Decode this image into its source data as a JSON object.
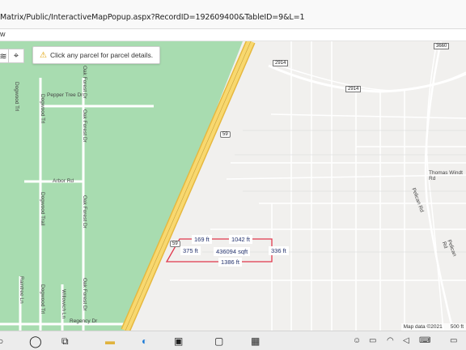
{
  "browser": {
    "url": "Matrix/Public/InteractiveMapPopup.aspx?RecordID=192609400&TableID=9&L=1",
    "menu_fragment": "w"
  },
  "map": {
    "hint_text": "Click any parcel for parcel details.",
    "controls": {
      "layers_icon": "layers-icon",
      "locate_icon": "locate-icon"
    },
    "highway_label": "59",
    "road_shields": [
      "2914",
      "2914",
      "3660"
    ],
    "street_labels": {
      "pepper_tree": "Pepper Tree Dr",
      "dogwood_trl_top": "Dogwood Trl",
      "oak_forest_top": "Oak Forest Dr",
      "oak_forest_2": "Oak Forest Dr",
      "arbor": "Arbor Rd",
      "dogwood_trl_mid": "Dogwood Trail",
      "oak_forest_low": "Oak Forest Dr",
      "dogwood_trl_low": "Dogwood Trl",
      "willowich": "Willowich Ln",
      "raintree": "Raintree Ln",
      "regency": "Regency Dr",
      "thomas_windt": "Thomas Windt Rd",
      "pelican_top": "Pelican Rd",
      "pelican_low": "Pelican Rd"
    },
    "parcel": {
      "top_left": "169 ft",
      "top_right": "1042 ft",
      "left": "375 ft",
      "right": "336 ft",
      "bottom": "1386 ft",
      "area": "436094 sqft"
    },
    "attribution": "Map data ©2021",
    "scale": "500 ft",
    "colors": {
      "green_area": "#a8dcb0",
      "highway": "#f4d365",
      "parcel_line": "#e0364b",
      "background": "#f1f0ee"
    }
  },
  "taskbar": {
    "icons": [
      "windows-start-icon",
      "search-circle-icon",
      "task-view-icon",
      "file-explorer-icon",
      "edge-browser-icon",
      "store-icon"
    ],
    "tray_icons": [
      "person-icon",
      "battery-icon",
      "wifi-icon",
      "volume-icon",
      "keyboard-icon",
      "notification-icon"
    ]
  }
}
